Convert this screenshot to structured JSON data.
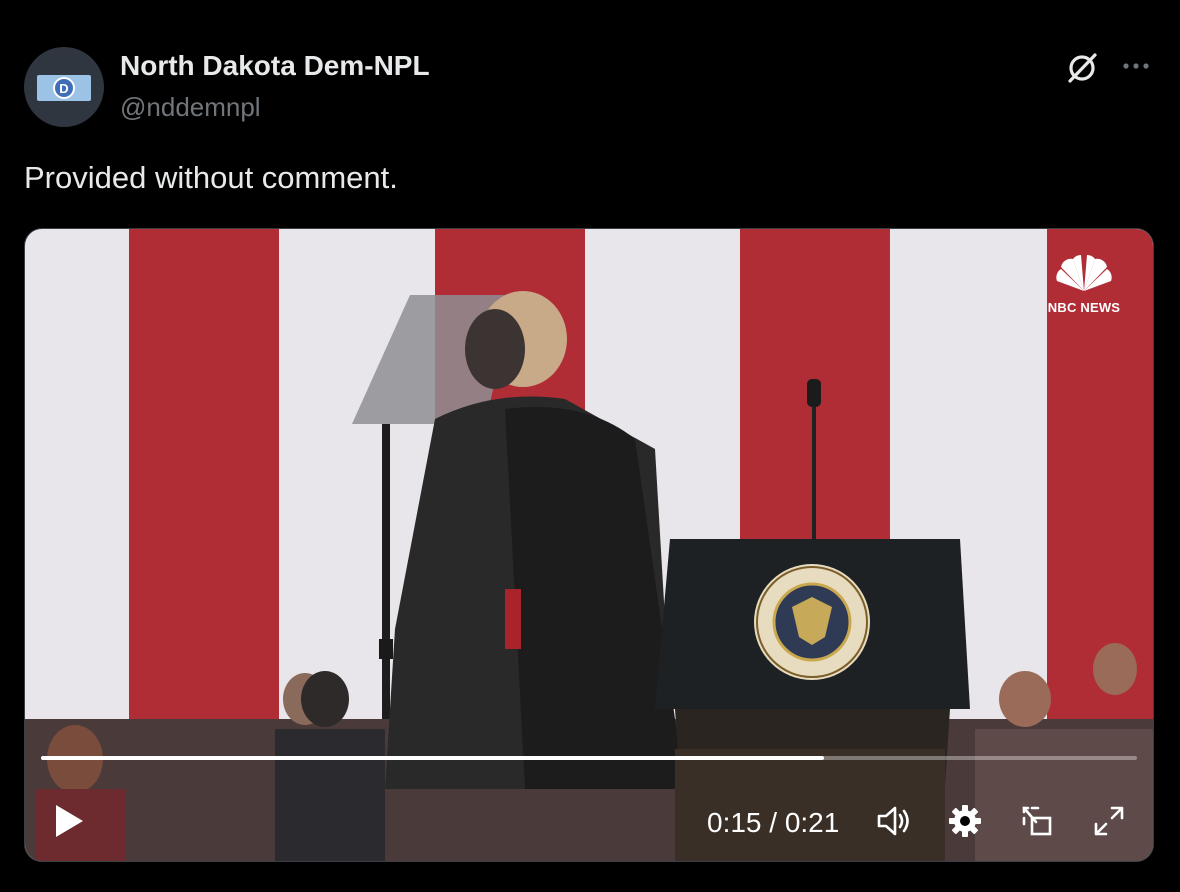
{
  "author": {
    "name": "North Dakota Dem-NPL",
    "handle": "@nddemnpl"
  },
  "tweet": {
    "text": "Provided without comment."
  },
  "video": {
    "watermark": "NBC NEWS",
    "current_time": "0:15",
    "duration": "0:21",
    "time_display": "0:15 / 0:21",
    "progress": 0.714,
    "seal_text": "SEAL OF THE PRESIDENT OF THE UNITED STATES"
  },
  "icons": {
    "grok": "grok-icon",
    "more": "more-icon",
    "play": "play-icon",
    "volume": "volume-icon",
    "settings": "gear-icon",
    "pip": "pip-icon",
    "fullscreen": "fullscreen-icon"
  },
  "colors": {
    "background": "#000000",
    "text_primary": "#e7e9ea",
    "text_secondary": "#71767b",
    "stripe_red": "#b5303a",
    "stripe_white": "#e9e7ea"
  }
}
